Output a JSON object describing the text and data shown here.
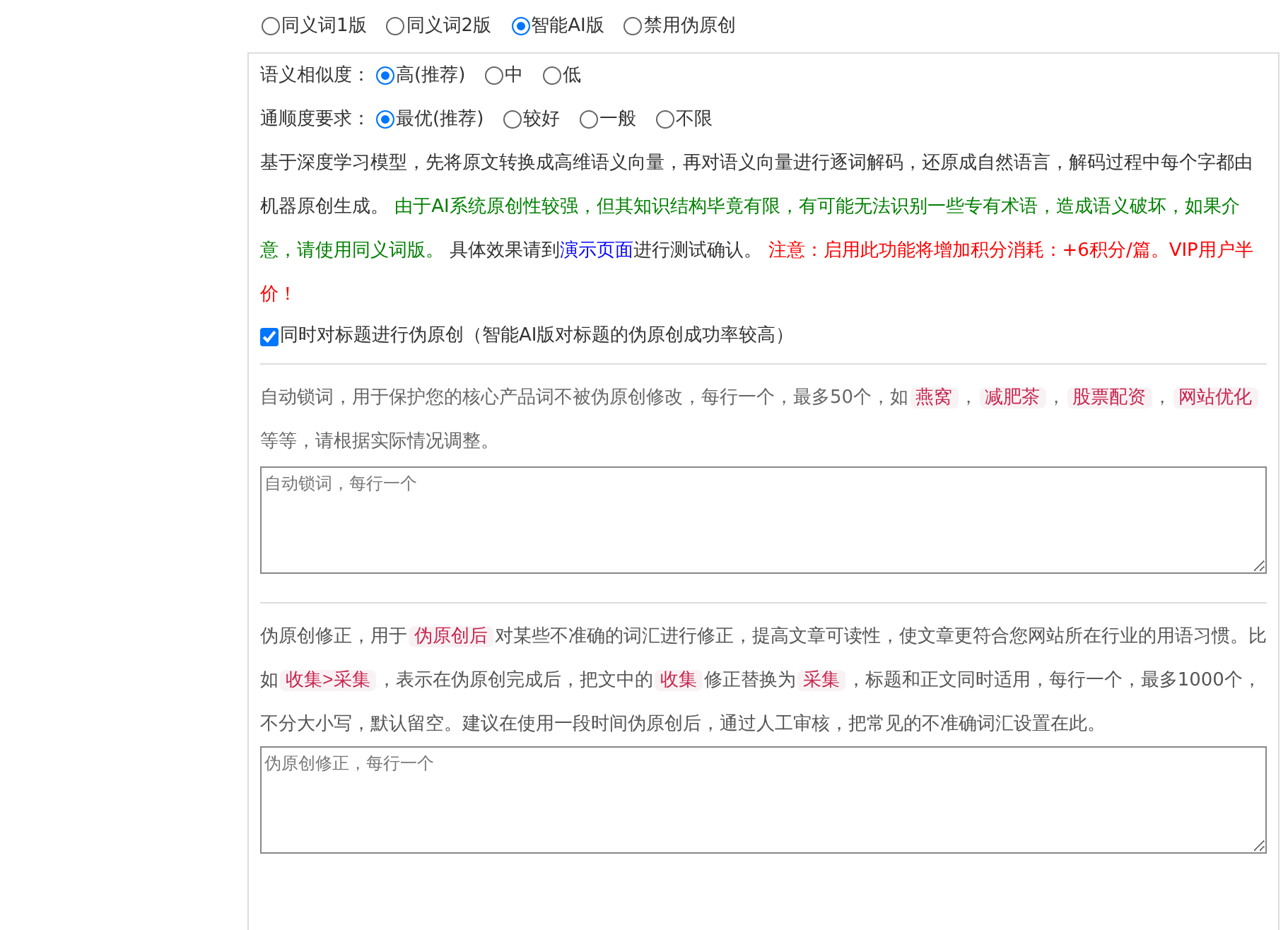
{
  "modes": [
    {
      "label": "同义词1版",
      "selected": false
    },
    {
      "label": "同义词2版",
      "selected": false
    },
    {
      "label": "智能AI版",
      "selected": true
    },
    {
      "label": "禁用伪原创",
      "selected": false
    }
  ],
  "settings": [
    {
      "label": "语义相似度：",
      "options": [
        {
          "label": "高(推荐)",
          "selected": true
        },
        {
          "label": "中",
          "selected": false
        },
        {
          "label": "低",
          "selected": false
        }
      ]
    },
    {
      "label": "通顺度要求：",
      "options": [
        {
          "label": "最优(推荐)",
          "selected": true
        },
        {
          "label": "较好",
          "selected": false
        },
        {
          "label": "一般",
          "selected": false
        },
        {
          "label": "不限",
          "selected": false
        }
      ]
    }
  ],
  "description": [
    {
      "kind": "plain",
      "text": "基于深度学习模型，先将原文转换成高维语义向量，再对语义向量进行逐词解码，还原成自然语言，解码过程中每个字都由机器原创生成。 "
    },
    {
      "kind": "notice",
      "text": "由于AI系统原创性较强，但其知识结构毕竟有限，有可能无法识别一些专有术语，造成语义破坏，如果介意，请使用同义词版。"
    },
    {
      "kind": "plain",
      "text": " 具体效果请到"
    },
    {
      "kind": "link",
      "text": "演示页面"
    },
    {
      "kind": "plain",
      "text": "进行测试确认。 "
    },
    {
      "kind": "warning",
      "text": "注意：启用此功能将增加积分消耗：+6积分/篇。VIP用户半价！"
    }
  ],
  "title_option": {
    "label": "同时对标题进行伪原创（智能AI版对标题的伪原创成功率较高）",
    "checked": true
  },
  "lock_words": {
    "description": [
      {
        "kind": "plain",
        "text": "自动锁词，用于保护您的核心产品词不被伪原创修改，每行一个，最多50个，如"
      },
      {
        "kind": "tag",
        "text": "燕窝"
      },
      {
        "kind": "plain",
        "text": "，"
      },
      {
        "kind": "tag",
        "text": "减肥茶"
      },
      {
        "kind": "plain",
        "text": "，"
      },
      {
        "kind": "tag",
        "text": "股票配资"
      },
      {
        "kind": "plain",
        "text": "，"
      },
      {
        "kind": "tag",
        "text": "网站优化"
      },
      {
        "kind": "plain",
        "text": "等等，请根据实际情况调整。"
      }
    ],
    "placeholder": "自动锁词，每行一个"
  },
  "corrections": {
    "description": [
      {
        "kind": "plain",
        "text": "伪原创修正，用于"
      },
      {
        "kind": "tag",
        "text": "伪原创后"
      },
      {
        "kind": "plain",
        "text": "对某些不准确的词汇进行修正，提高文章可读性，使文章更符合您网站所在行业的用语习惯。比如"
      },
      {
        "kind": "tag",
        "text": "收集>采集"
      },
      {
        "kind": "plain",
        "text": "，表示在伪原创完成后，把文中的"
      },
      {
        "kind": "tag",
        "text": "收集"
      },
      {
        "kind": "plain",
        "text": "修正替换为"
      },
      {
        "kind": "tag",
        "text": "采集"
      },
      {
        "kind": "plain",
        "text": "，标题和正文同时适用，每行一个，最多1000个，不分大小写，默认留空。建议在使用一段时间伪原创后，通过人工审核，把常见的不准确词汇设置在此。"
      }
    ],
    "placeholder": "伪原创修正，每行一个"
  }
}
